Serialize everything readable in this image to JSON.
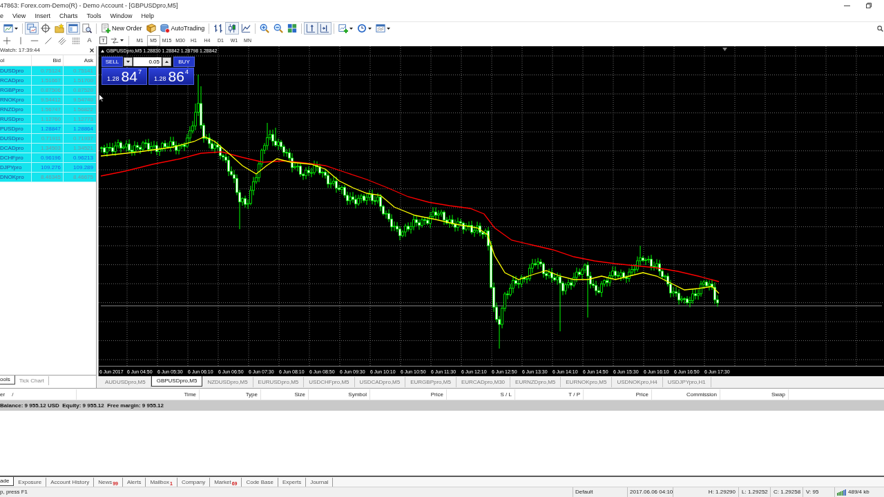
{
  "window": {
    "title": "47863: Forex.com-Demo(R) - Demo Account - [GBPUSDpro,M5]"
  },
  "menu": [
    "e",
    "View",
    "Insert",
    "Charts",
    "Tools",
    "Window",
    "Help"
  ],
  "toolbar": [
    {
      "kind": "newchart",
      "pressed": false,
      "dropdown": true
    },
    {
      "kind": "separator"
    },
    {
      "kind": "profiles",
      "pressed": true
    },
    {
      "kind": "target",
      "pressed": false
    },
    {
      "kind": "folder",
      "pressed": false
    },
    {
      "kind": "window",
      "pressed": true
    },
    {
      "kind": "tester",
      "pressed": false
    },
    {
      "kind": "separator"
    },
    {
      "kind": "order",
      "label": "New Order",
      "pressed": false
    },
    {
      "kind": "editor",
      "pressed": false
    },
    {
      "kind": "autotrading",
      "label": "AutoTrading",
      "pressed": false
    },
    {
      "kind": "separator"
    },
    {
      "kind": "bars",
      "pressed": false
    },
    {
      "kind": "candles",
      "pressed": true
    },
    {
      "kind": "line",
      "pressed": false
    },
    {
      "kind": "separator"
    },
    {
      "kind": "zoomin",
      "pressed": false
    },
    {
      "kind": "zoomout",
      "pressed": false
    },
    {
      "kind": "tile",
      "pressed": false
    },
    {
      "kind": "separator"
    },
    {
      "kind": "shift",
      "pressed": true
    },
    {
      "kind": "scroll",
      "pressed": true
    },
    {
      "kind": "separator"
    },
    {
      "kind": "indicators",
      "pressed": false,
      "dropdown": true
    },
    {
      "kind": "periods",
      "pressed": false,
      "dropdown": true
    },
    {
      "kind": "templates",
      "pressed": false,
      "dropdown": true
    }
  ],
  "drawing_toolbar": [
    {
      "kind": "cross"
    },
    {
      "kind": "vline"
    },
    {
      "kind": "hline"
    },
    {
      "kind": "trend"
    },
    {
      "kind": "channel"
    },
    {
      "kind": "fibo"
    },
    {
      "kind": "text",
      "label": "A"
    },
    {
      "kind": "textbox",
      "label": "T"
    },
    {
      "kind": "arrows",
      "dropdown": true
    },
    {
      "kind": "separator"
    },
    {
      "kind": "period",
      "label": "M1",
      "selected": false
    },
    {
      "kind": "period",
      "label": "M5",
      "selected": true
    },
    {
      "kind": "period",
      "label": "M15",
      "selected": false
    },
    {
      "kind": "period",
      "label": "M30",
      "selected": false
    },
    {
      "kind": "period",
      "label": "H1",
      "selected": false
    },
    {
      "kind": "period",
      "label": "H4",
      "selected": false
    },
    {
      "kind": "period",
      "label": "D1",
      "selected": false
    },
    {
      "kind": "period",
      "label": "W1",
      "selected": false
    },
    {
      "kind": "period",
      "label": "MN",
      "selected": false
    }
  ],
  "market_watch": {
    "title": "Watch: 17:39:44",
    "columns": [
      "ol",
      "Bid",
      "Ask"
    ],
    "rows": [
      {
        "symbol": "DUSDpro",
        "bid": "0.75124",
        "ask": "0.75141",
        "rising": false
      },
      {
        "symbol": "RCADpro",
        "bid": "1.51667",
        "ask": "1.51700",
        "rising": false
      },
      {
        "symbol": "RGBPpro",
        "bid": "0.87506",
        "ask": "0.87520",
        "rising": false
      },
      {
        "symbol": "RNOKpro",
        "bid": "9.54412",
        "ask": "9.54740",
        "rising": false
      },
      {
        "symbol": "RNZDpro",
        "bid": "1.56747",
        "ask": "1.56822",
        "rising": false
      },
      {
        "symbol": "RUSDpro",
        "bid": "1.12760",
        "ask": "1.12773",
        "rising": false
      },
      {
        "symbol": "PUSDpro",
        "bid": "1.28847",
        "ask": "1.28864",
        "rising": true
      },
      {
        "symbol": "DUSDpro",
        "bid": "0.71911",
        "ask": "0.71937",
        "rising": false
      },
      {
        "symbol": "DCADpro",
        "bid": "1.34503",
        "ask": "1.34521",
        "rising": false
      },
      {
        "symbol": "DCHFpro",
        "bid": "0.96196",
        "ask": "0.96213",
        "rising": true
      },
      {
        "symbol": "DJPYpro",
        "bid": "109.276",
        "ask": "109.289",
        "rising": true
      },
      {
        "symbol": "DNOKpro",
        "bid": "8.46345",
        "ask": "8.46675",
        "rising": false
      }
    ],
    "tabs": [
      {
        "label": "ools",
        "selected": true
      },
      {
        "label": "Tick Chart",
        "selected": false
      }
    ]
  },
  "chart": {
    "title": "GBPUSDpro,M5 1.28830 1.28842 1.28798 1.28842",
    "one_click": {
      "lot": "0.05",
      "sell": {
        "label": "SELL",
        "price": {
          "prefix": "1.28",
          "pips": "84",
          "point": "7"
        }
      },
      "buy": {
        "label": "BUY",
        "price": {
          "prefix": "1.28",
          "pips": "86",
          "point": "4"
        }
      }
    },
    "time_axis": [
      "6 Jun 2017",
      "6 Jun 04:50",
      "6 Jun 05:30",
      "6 Jun 06:10",
      "6 Jun 06:50",
      "6 Jun 07:30",
      "6 Jun 08:10",
      "6 Jun 08:50",
      "6 Jun 09:30",
      "6 Jun 10:10",
      "6 Jun 10:50",
      "6 Jun 11:30",
      "6 Jun 12:10",
      "6 Jun 12:50",
      "6 Jun 13:30",
      "6 Jun 14:10",
      "6 Jun 14:50",
      "6 Jun 15:30",
      "6 Jun 16:10",
      "6 Jun 16:50",
      "6 Jun 17:30"
    ]
  },
  "chart_tabs": [
    {
      "label": "AUDUSDpro,M5",
      "selected": false
    },
    {
      "label": "GBPUSDpro,M5",
      "selected": true
    },
    {
      "label": "NZDUSDpro,M5",
      "selected": false
    },
    {
      "label": "EURUSDpro,M5",
      "selected": false
    },
    {
      "label": "USDCHFpro,M5",
      "selected": false
    },
    {
      "label": "USDCADpro,M5",
      "selected": false
    },
    {
      "label": "EURGBPpro,M5",
      "selected": false
    },
    {
      "label": "EURCADpro,M30",
      "selected": false
    },
    {
      "label": "EURNZDpro,M5",
      "selected": false
    },
    {
      "label": "EURNOKpro,M5",
      "selected": false
    },
    {
      "label": "USDNOKpro,H4",
      "selected": false
    },
    {
      "label": "USDJPYpro,H1",
      "selected": false
    }
  ],
  "terminal": {
    "columns": [
      "er",
      "Time",
      "Type",
      "Size",
      "Symbol",
      "Price",
      "S / L",
      "T / P",
      "Price",
      "Commission",
      "Swap"
    ],
    "sort_indicator": "/",
    "balance": "Balance: 9 955.12 USD  Equity: 9 955.12  Free margin: 9 955.12",
    "tabs": [
      {
        "label": "ade",
        "selected": true
      },
      {
        "label": "Exposure",
        "selected": false
      },
      {
        "label": "Account History",
        "selected": false
      },
      {
        "label": "News",
        "badge": "99",
        "selected": false
      },
      {
        "label": "Alerts",
        "selected": false
      },
      {
        "label": "Mailbox",
        "badge": "1",
        "selected": false
      },
      {
        "label": "Company",
        "selected": false
      },
      {
        "label": "Market",
        "badge": "69",
        "selected": false
      },
      {
        "label": "Code Base",
        "selected": false
      },
      {
        "label": "Experts",
        "selected": false
      },
      {
        "label": "Journal",
        "selected": false
      }
    ]
  },
  "status_bar": {
    "help": "p, press F1",
    "profile": "Default",
    "time": "2017.06.06 04:10",
    "high": "H: 1.29290",
    "low": "L: 1.29252",
    "close": "C: 1.29258",
    "volume": "V: 95",
    "traffic": "489/4 kb"
  }
}
